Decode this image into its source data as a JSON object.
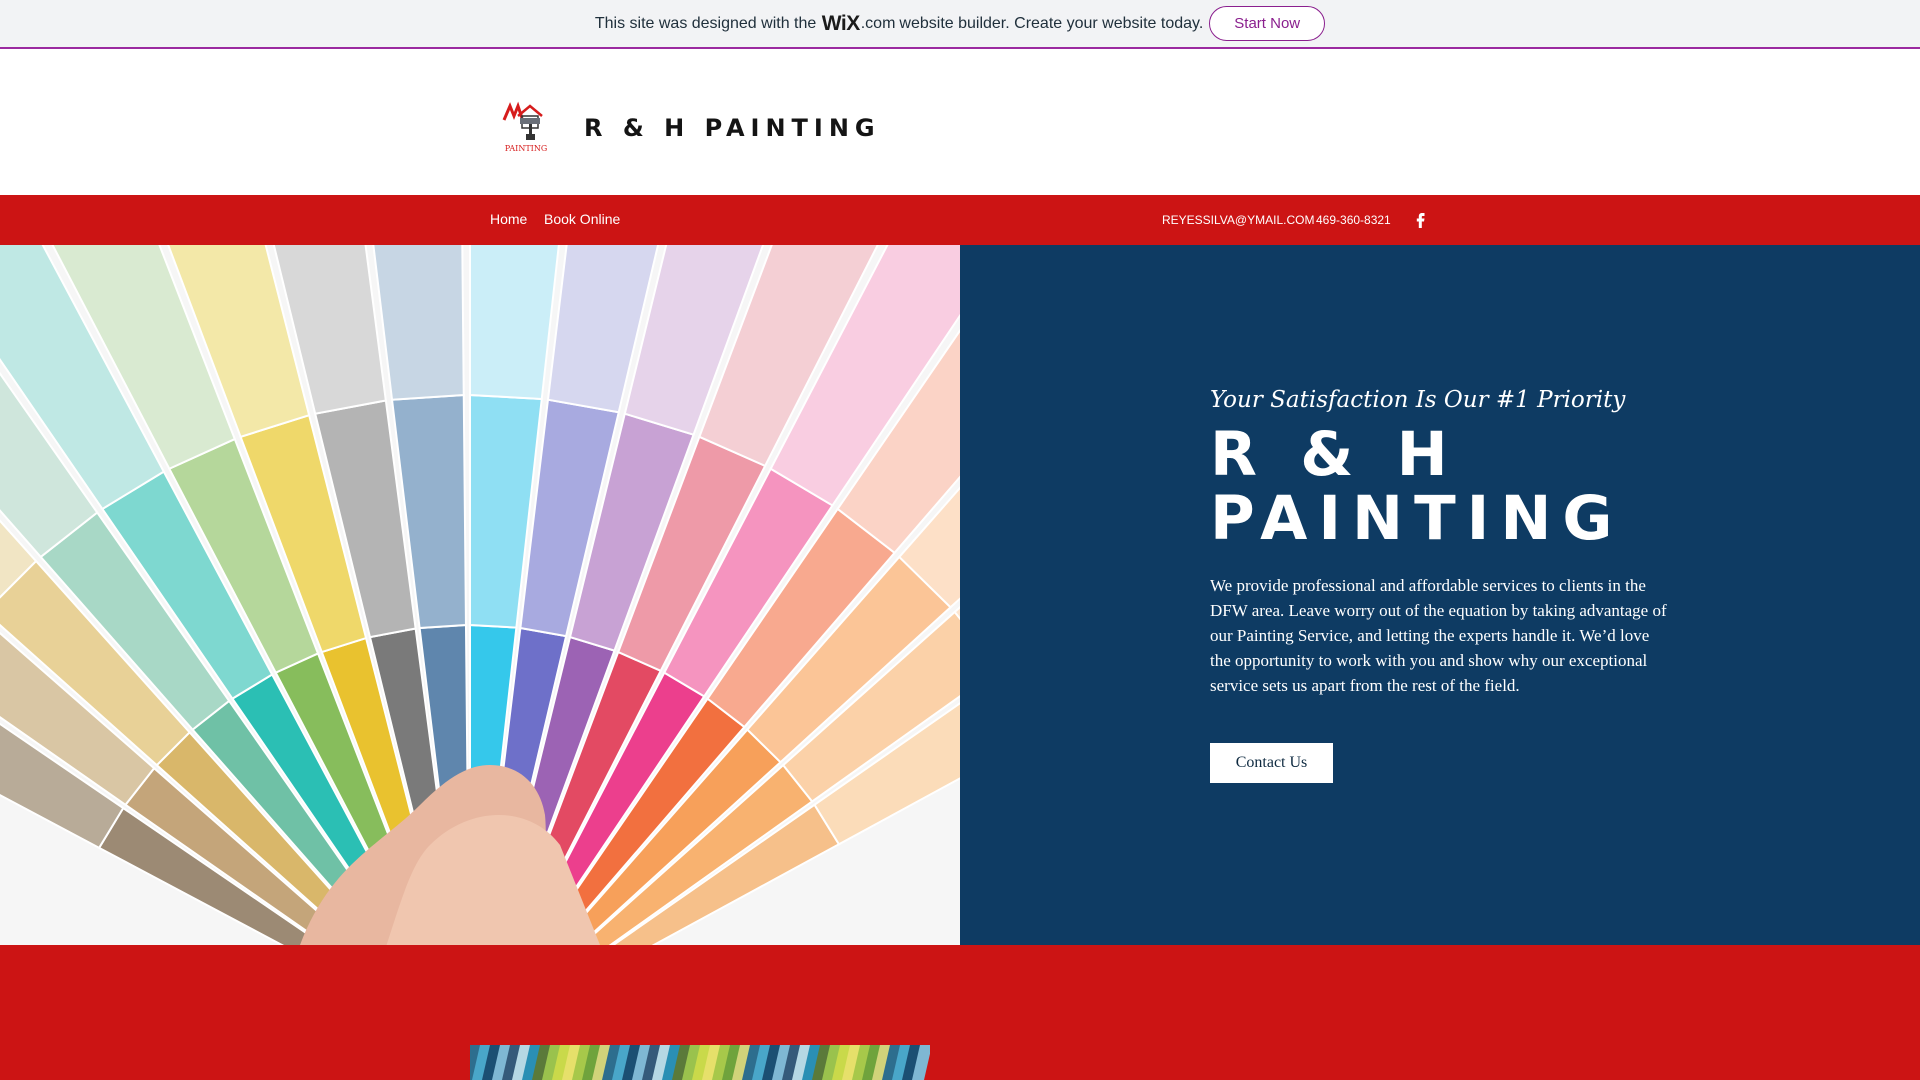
{
  "wix_banner": {
    "text_before": "This site was designed with the",
    "logo": "WiX",
    "dotcom": ".com",
    "text_after": "website builder. Create your website today.",
    "button_label": "Start Now"
  },
  "header": {
    "brand_title": "R & H PAINTING",
    "logo_text": "PAINTING"
  },
  "nav": {
    "links": [
      "Home",
      "Book Online"
    ],
    "email": "REYESSILVA@YMAIL.COM",
    "phone": "469-360-8321",
    "social_icon": "facebook-icon"
  },
  "hero": {
    "tagline": "Your Satisfaction Is Our #1 Priority",
    "title_line1": "R & H",
    "title_line2": "PAINTING",
    "description": "We provide professional and affordable services to clients in the DFW area. Leave worry out of the equation by taking advantage of our Painting Service, and letting the experts handle it. We’d love the opportunity to work with you and show why our exceptional service sets us apart from the rest of the field.",
    "button_label": "Contact Us"
  },
  "colors": {
    "brand_red": "#cc1414",
    "hero_navy": "#0e3b63",
    "wix_purple": "#8a1f8e"
  }
}
